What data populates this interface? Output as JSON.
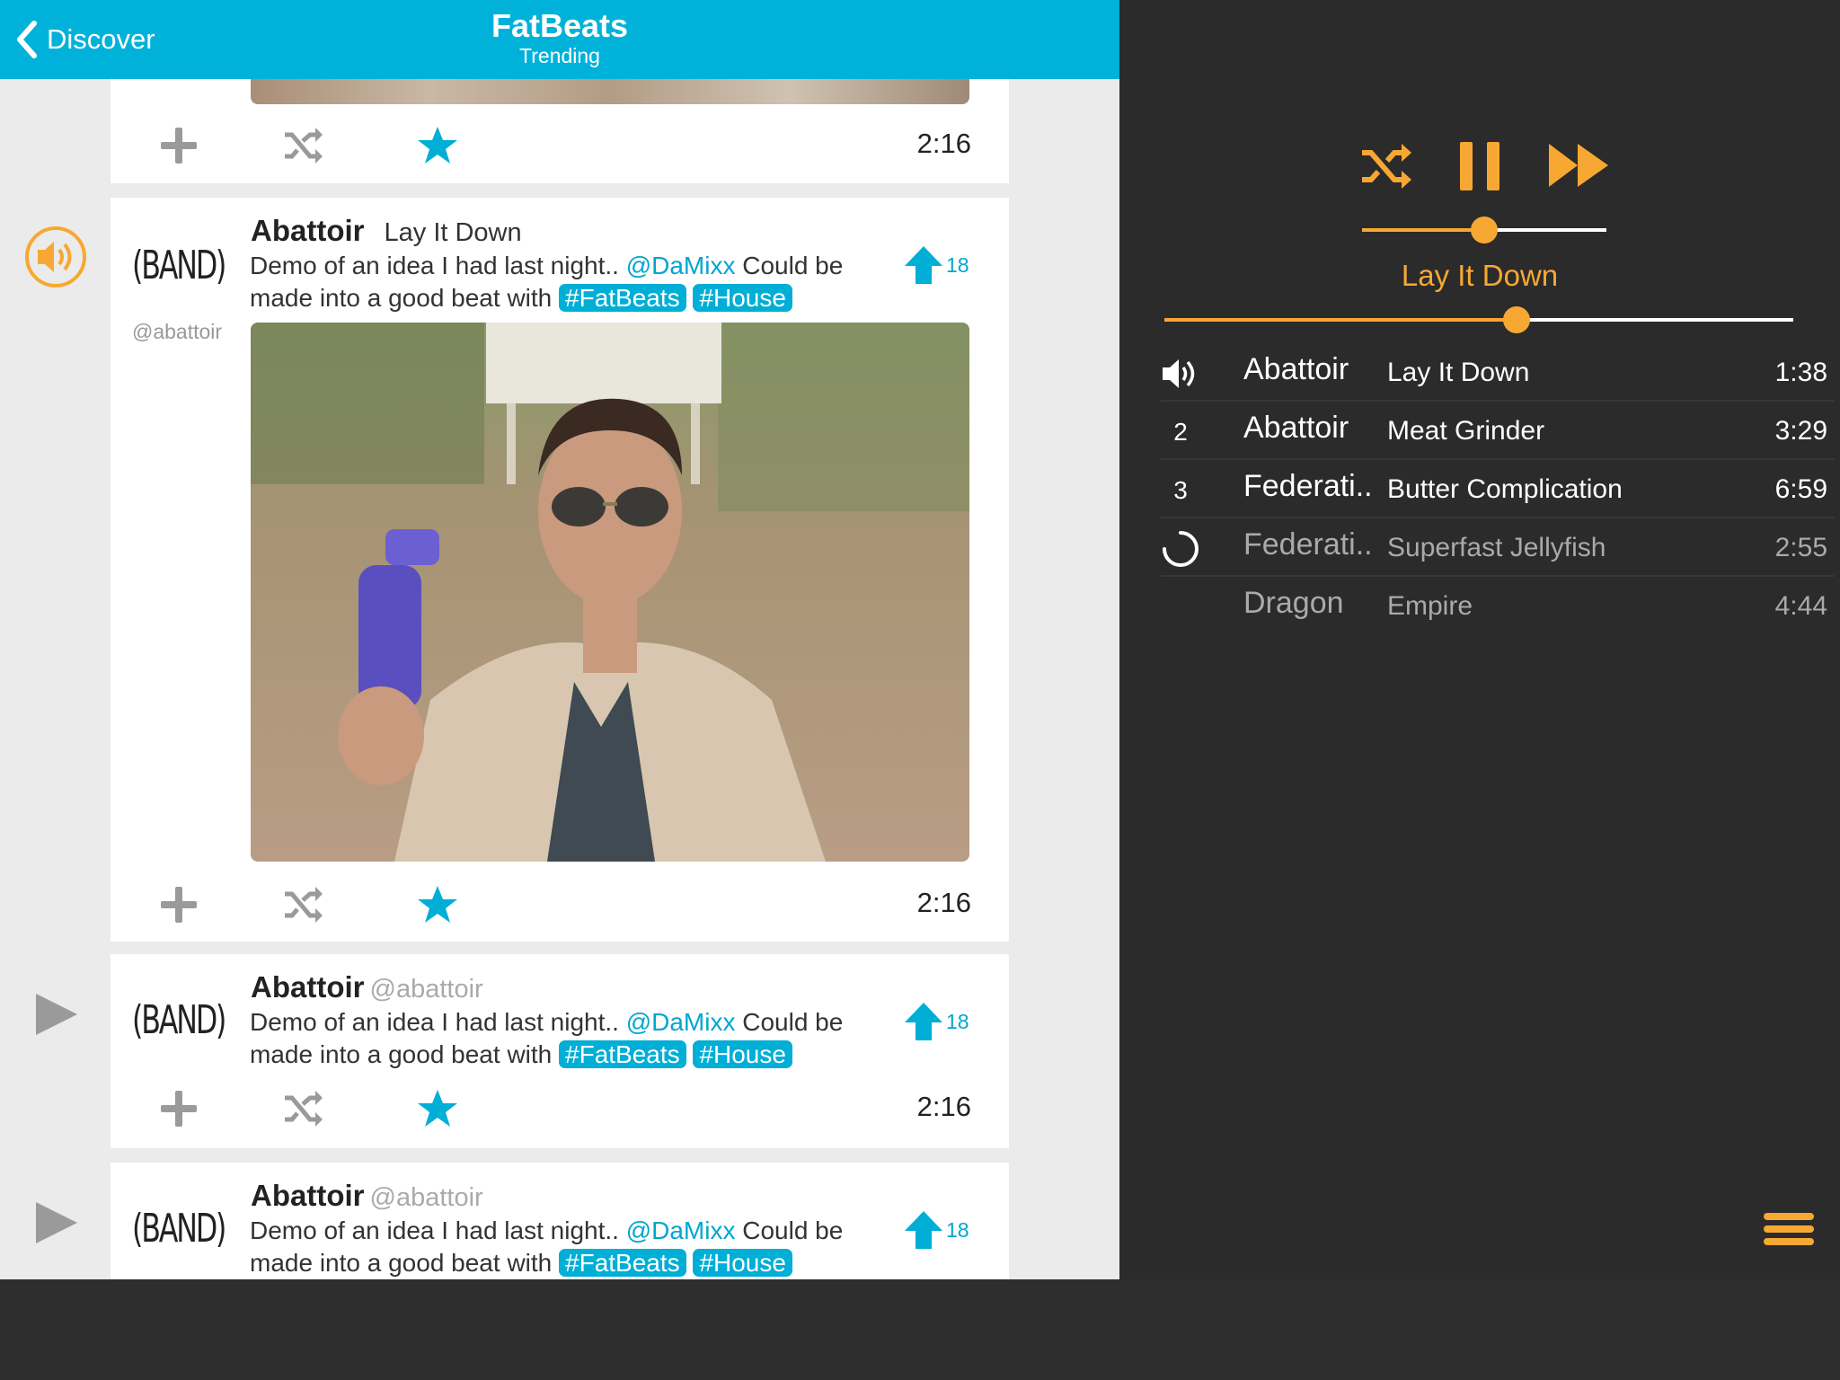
{
  "header": {
    "back_label": "Discover",
    "title": "FatBeats",
    "subtitle": "Trending"
  },
  "colors": {
    "accent": "#00b2d9",
    "player_accent": "#f7a832",
    "player_bg": "#2b2b2b"
  },
  "feed": {
    "top_card": {
      "duration": "2:16"
    },
    "cards": [
      {
        "logo": "(BAND)",
        "artist": "Abattoir",
        "song": "Lay It Down",
        "handle": "@abattoir",
        "desc_text": "Demo of an idea I had last night.. ",
        "mention": "@DaMixx",
        "desc_text2": " Could be made into a good beat with ",
        "tags": [
          "#FatBeats",
          "#House"
        ],
        "votes": "18",
        "duration": "2:16",
        "state_icon": "speaker-icon"
      },
      {
        "logo": "(BAND)",
        "artist": "Abattoir",
        "handle": "@abattoir",
        "desc_text": "Demo of an idea I had last night.. ",
        "mention": "@DaMixx",
        "desc_text2": " Could be made into a good beat with ",
        "tags": [
          "#FatBeats",
          "#House"
        ],
        "votes": "18",
        "duration": "2:16",
        "state_icon": "play-icon"
      },
      {
        "logo": "(BAND)",
        "artist": "Abattoir",
        "handle": "@abattoir",
        "desc_text": "Demo of an idea I had last night.. ",
        "mention": "@DaMixx",
        "desc_text2": " Could be made into a good beat with ",
        "tags": [
          "#FatBeats",
          "#House"
        ],
        "votes": "18",
        "state_icon": "play-icon"
      }
    ]
  },
  "player": {
    "volume_fraction": 0.5,
    "progress_fraction": 0.56,
    "now_playing": "Lay It Down",
    "tracks": [
      {
        "marker": "speaker-icon",
        "artist": "Abattoir",
        "song": "Lay It Down",
        "time": "1:38"
      },
      {
        "marker": "2",
        "artist": "Abattoir",
        "song": "Meat Grinder",
        "time": "3:29"
      },
      {
        "marker": "3",
        "artist": "Federati..",
        "song": "Butter Complication",
        "time": "6:59"
      },
      {
        "marker": "loading-icon",
        "artist": "Federati..",
        "song": "Superfast Jellyfish",
        "time": "2:55"
      },
      {
        "marker": "",
        "artist": "Dragon",
        "song": "Empire",
        "time": "4:44"
      }
    ]
  }
}
